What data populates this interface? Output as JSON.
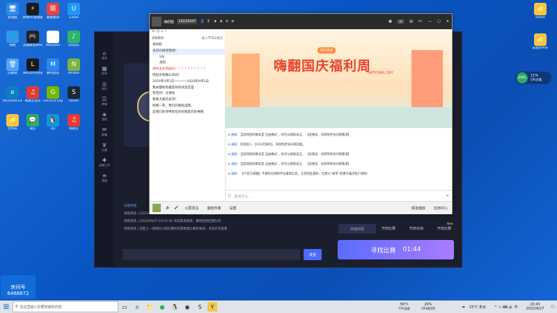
{
  "desktop": {
    "left_icons": [
      {
        "label": "此电脑",
        "color": "#2f8ae6",
        "glyph": "🖥"
      },
      {
        "label": "网易UU加速器",
        "color": "#1a1a1a",
        "glyph": "⚡"
      },
      {
        "label": "超级驱动",
        "color": "#e84141",
        "glyph": "驱"
      },
      {
        "label": "uTools",
        "color": "#2196f3",
        "glyph": "U"
      },
      {
        "label": "网络",
        "color": "#3b93e6",
        "glyph": "🌐"
      },
      {
        "label": "英雄联盟WeGame版",
        "color": "#222",
        "glyph": "🎮"
      },
      {
        "label": "WeGame",
        "color": "#ffffff",
        "glyph": "W"
      },
      {
        "label": "QQ音乐",
        "color": "#2db36b",
        "glyph": "♪"
      },
      {
        "label": "回收站",
        "color": "#4da3ff",
        "glyph": "🗑"
      },
      {
        "label": "WeGame英雄联盟",
        "color": "#1a1a1a",
        "glyph": "L"
      },
      {
        "label": "腾讯会议",
        "color": "#2b88f0",
        "glyph": "M"
      },
      {
        "label": "NVIDIA",
        "color": "#7cb342",
        "glyph": "N"
      },
      {
        "label": "Microsoft Edge",
        "color": "#0d7ec2",
        "glyph": "e"
      },
      {
        "label": "网易云音乐",
        "color": "#e53935",
        "glyph": "♫"
      },
      {
        "label": "GeForce Experience",
        "color": "#76b900",
        "glyph": "G"
      },
      {
        "label": "Steam",
        "color": "#1b2838",
        "glyph": "S"
      },
      {
        "label": "文件夹",
        "color": "#f4c542",
        "glyph": "📁"
      },
      {
        "label": "微信",
        "color": "#2aae67",
        "glyph": "💬"
      },
      {
        "label": "QQ",
        "color": "#1296db",
        "glyph": "🐧"
      },
      {
        "label": "网易云",
        "color": "#e53935",
        "glyph": "♫"
      }
    ],
    "right_icons": [
      {
        "label": "steam",
        "color": "#f4c542",
        "glyph": "📁"
      },
      {
        "label": "新建文件夹",
        "color": "#f4c542",
        "glyph": "📁"
      }
    ],
    "perf_widget": {
      "cpu_percent": "29%",
      "usage_label": "11%",
      "usage_sub": "CPU负载"
    },
    "overlay_badge": {
      "label": "房间号",
      "value": "6468872"
    }
  },
  "game_client": {
    "sidebar": [
      "首页",
      "房间",
      "排行",
      "商城",
      "游戏",
      "邮箱",
      "比赛",
      "创建工作",
      "频道",
      "设置"
    ],
    "chat_log": [
      "分组对话",
      "系统消息 | 2022/09/27-19:55:41 有玩家未接受，重新回到匹配队列",
      "系统消息 | 2022/09/27-19:55:41 有玩家未接受，重新回到匹配队列",
      "系统消息 | 匹配上一场组队小组比赛的玩家数量以解析收录，点击打开查看"
    ],
    "send_button": "发送",
    "options": [
      "快速匹配",
      "开启比赛",
      "开启对战",
      "开启比赛"
    ],
    "find_match_label": "寻找比赛",
    "find_match_timer": "01:44",
    "new_badge": "New"
  },
  "qq": {
    "title": "海豹脸",
    "room_id": "19224347",
    "member_count": "2",
    "left_header_left": "高级模式",
    "left_header_right": "加入不可以发言",
    "tree": [
      "海豹脸",
      "主日众接待现场！",
      "UN",
      "海豹",
      "海豹主主持娱乐！！！！！！！！！！",
      "吃饭水果确认房间！",
      "2020年4月1日～～～～2020年4月1日",
      "我关都很有趣有效的状态还是",
      "有空的！过来给",
      "看看大家的支持！",
      "刚刚一年，我们的继续选嗯。",
      "是我们的领导现在的好朋友的的事情"
    ],
    "banner": {
      "tag": "9月活动",
      "title": "嗨翻国庆福利周",
      "sub": "NATIONAL DAY"
    },
    "messages": [
      {
        "tag": "通知:",
        "text": "当前频道的模式是 自由模式 ，你可以随意发言。 【查看房、同频等更多同频看理】"
      },
      {
        "tag": "通知:",
        "text": "欢迎进入 【众乐可真的】，同频等更多同频功能。"
      },
      {
        "tag": "通知:",
        "text": "当前频道的模式是 自由模式 ，你可以随意发言。 【查看房、同频等更多同频看理】"
      },
      {
        "tag": "通知:",
        "text": "当前频道的模式是 自由模式 ，你可以随意发言。 【查看房、同频等更多同频看理】"
      },
      {
        "tag": "通知:",
        "text": "【YY官方提醒】不要轻信网络平台兼职信息，尤其陌生兼职、切莫以“刷单”的模子骗走账户钱财！"
      }
    ],
    "input_placeholder": "说点什么...",
    "bottom_items": [
      "公屏发言",
      "播放伴奏",
      "设置"
    ],
    "bottom_right": [
      "频道播放",
      "应用中心"
    ]
  },
  "taskbar": {
    "search_placeholder": "在这里输入你要搜索的内容",
    "weather": "23°C 多云",
    "time": "20:43",
    "date": "2022/9/27",
    "cpu_temp": "56°C",
    "cpu_temp_label": "CPU温度",
    "cpu_usage": "29%",
    "cpu_usage_label": "CPU使用率"
  }
}
